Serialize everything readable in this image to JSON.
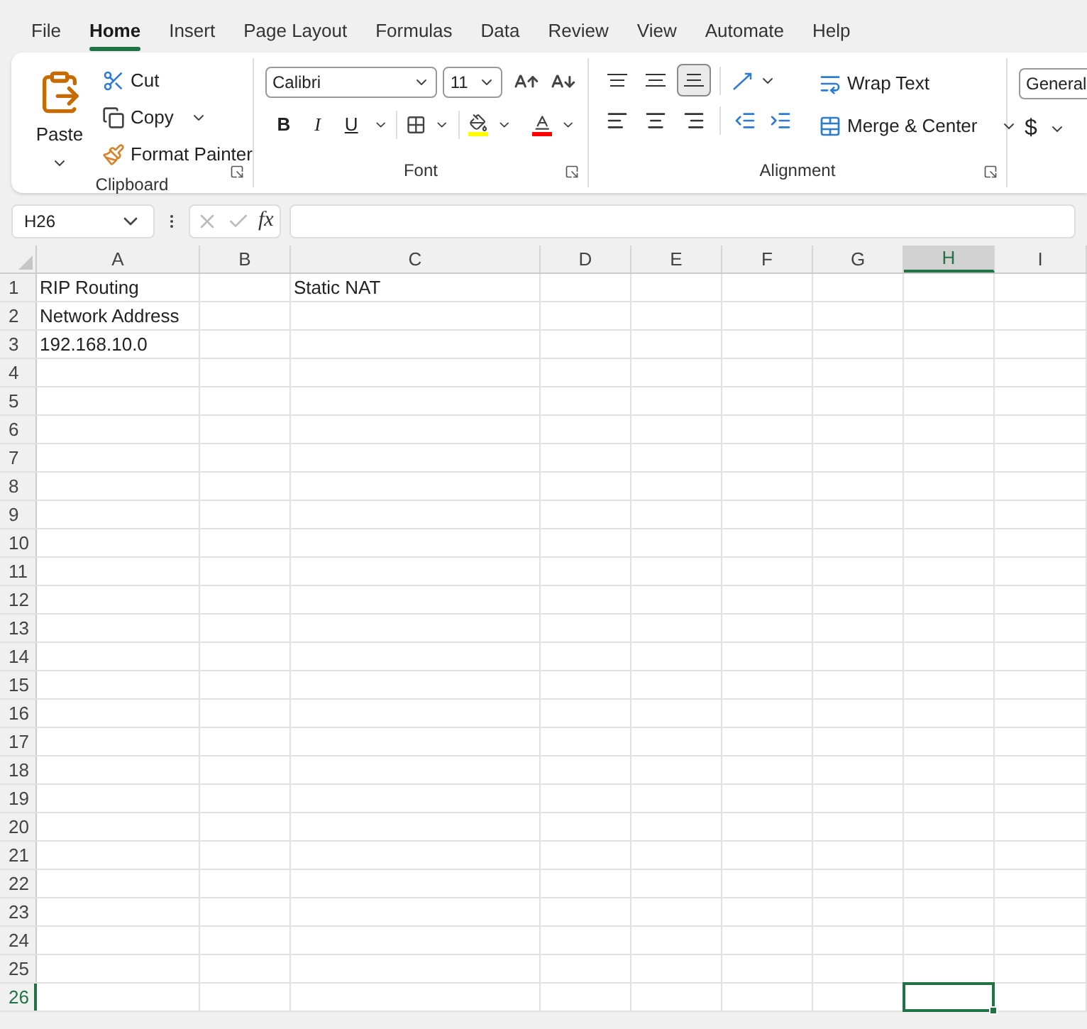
{
  "menu_tabs": [
    {
      "label": "File",
      "selected": false
    },
    {
      "label": "Home",
      "selected": true
    },
    {
      "label": "Insert",
      "selected": false
    },
    {
      "label": "Page Layout",
      "selected": false
    },
    {
      "label": "Formulas",
      "selected": false
    },
    {
      "label": "Data",
      "selected": false
    },
    {
      "label": "Review",
      "selected": false
    },
    {
      "label": "View",
      "selected": false
    },
    {
      "label": "Automate",
      "selected": false
    },
    {
      "label": "Help",
      "selected": false
    }
  ],
  "ribbon": {
    "clipboard": {
      "label": "Clipboard",
      "paste": "Paste",
      "cut": "Cut",
      "copy": "Copy",
      "format_painter": "Format Painter"
    },
    "font": {
      "label": "Font",
      "font_name": "Calibri",
      "font_size": "11",
      "bold": "B",
      "italic": "I",
      "underline": "U"
    },
    "alignment": {
      "label": "Alignment",
      "vertical_buttons": [
        {
          "kind": "top",
          "selected": false
        },
        {
          "kind": "middle",
          "selected": false
        },
        {
          "kind": "bottom",
          "selected": true
        }
      ],
      "wrap_text": "Wrap Text",
      "merge_center": "Merge & Center"
    },
    "number": {
      "format": "General",
      "currency": "$"
    }
  },
  "formula_bar": {
    "name_box": "H26",
    "function_label": "fx"
  },
  "sheet": {
    "columns": [
      {
        "label": "A",
        "selected": false
      },
      {
        "label": "B",
        "selected": false
      },
      {
        "label": "C",
        "selected": false
      },
      {
        "label": "D",
        "selected": false
      },
      {
        "label": "E",
        "selected": false
      },
      {
        "label": "F",
        "selected": false
      },
      {
        "label": "G",
        "selected": false
      },
      {
        "label": "H",
        "selected": true
      },
      {
        "label": "I",
        "selected": false
      }
    ],
    "rows": [
      {
        "label": "1",
        "selected": false,
        "cells": [
          "RIP Routing",
          null,
          "Static NAT"
        ]
      },
      {
        "label": "2",
        "selected": false,
        "cells": [
          "Network Address"
        ]
      },
      {
        "label": "3",
        "selected": false,
        "cells": [
          "192.168.10.0"
        ]
      },
      {
        "label": "4",
        "selected": false
      },
      {
        "label": "5",
        "selected": false
      },
      {
        "label": "6",
        "selected": false
      },
      {
        "label": "7",
        "selected": false
      },
      {
        "label": "8",
        "selected": false
      },
      {
        "label": "9",
        "selected": false
      },
      {
        "label": "10",
        "selected": false
      },
      {
        "label": "11",
        "selected": false
      },
      {
        "label": "12",
        "selected": false
      },
      {
        "label": "13",
        "selected": false
      },
      {
        "label": "14",
        "selected": false
      },
      {
        "label": "15",
        "selected": false
      },
      {
        "label": "16",
        "selected": false
      },
      {
        "label": "17",
        "selected": false
      },
      {
        "label": "18",
        "selected": false
      },
      {
        "label": "19",
        "selected": false
      },
      {
        "label": "20",
        "selected": false
      },
      {
        "label": "21",
        "selected": false
      },
      {
        "label": "22",
        "selected": false
      },
      {
        "label": "23",
        "selected": false
      },
      {
        "label": "24",
        "selected": false
      },
      {
        "label": "25",
        "selected": false
      },
      {
        "label": "26",
        "selected": true
      }
    ]
  }
}
